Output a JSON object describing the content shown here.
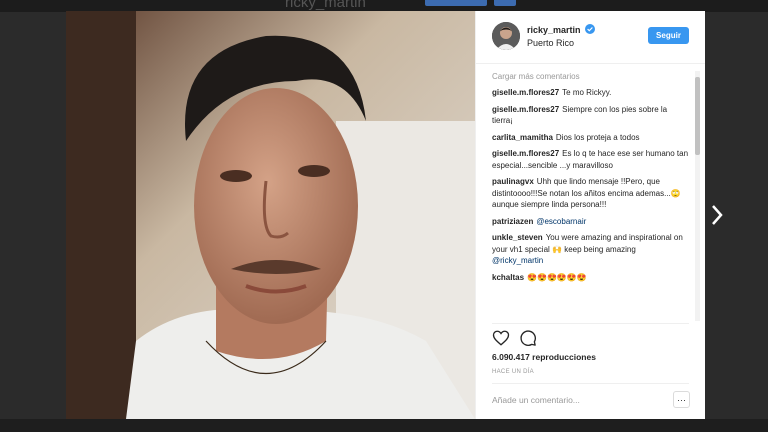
{
  "backdrop": {
    "profile_username": "ricky_martin"
  },
  "post": {
    "username": "ricky_martin",
    "location": "Puerto Rico",
    "follow_label": "Seguir",
    "load_more_label": "Cargar más comentarios",
    "comments": [
      {
        "user": "giselle.m.flores27",
        "text": "Te mo Rickyy."
      },
      {
        "user": "giselle.m.flores27",
        "text": "Siempre con los pies sobre la tierra¡"
      },
      {
        "user": "carlita_mamitha",
        "text": "Dios los proteja a todos"
      },
      {
        "user": "giselle.m.flores27",
        "text": "Es lo q te hace ese ser humano tan especial...sencible ...y maravilloso"
      },
      {
        "user": "paulinagvx",
        "text": "Uhh que lindo mensaje !!Pero, que distintoooo!!!Se notan los añitos encima ademas...🙄aunque siempre linda persona!!!"
      },
      {
        "user": "patriziazen",
        "text": "",
        "mention": "@escobarnair"
      },
      {
        "user": "unkle_steven",
        "text": "You were amazing and inspirational on your vh1 special 🙌 keep being amazing",
        "mention": "@ricky_martin"
      },
      {
        "user": "kchaltas",
        "text": "😍😍😍😍😍😍"
      }
    ],
    "views": "6.090.417 reproducciones",
    "time_ago": "HACE UN DÍA",
    "comment_placeholder": "Añade un comentario...",
    "more_options_label": "···"
  },
  "colors": {
    "accent": "#3897f0",
    "text": "#262626",
    "muted": "#999999"
  }
}
